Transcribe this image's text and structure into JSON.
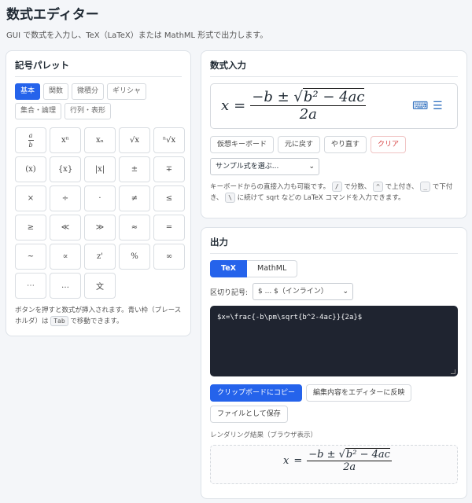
{
  "header": {
    "title": "数式エディター",
    "subtitle": "GUI で数式を入力し、TeX（LaTeX）または MathML 形式で出力します。"
  },
  "palette": {
    "title": "記号パレット",
    "tabs": [
      "基本",
      "関数",
      "微積分",
      "ギリシャ",
      "集合・論理",
      "行列・表形"
    ],
    "keys": [
      "a/b",
      "xⁿ",
      "xₙ",
      "√x",
      "ⁿ√x",
      "(x)",
      "{x}",
      "|x|",
      "±",
      "∓",
      "×",
      "÷",
      "·",
      "≠",
      "≤",
      "≥",
      "≪",
      "≫",
      "≈",
      "=",
      "~",
      "∝",
      "z'",
      "%",
      "∞",
      "⋯",
      "…",
      "文"
    ],
    "help_1": "ボタンを押すと数式が挿入されます。青い枠（プレースホルダ）は",
    "help_key": "Tab",
    "help_2": "で移動できます。"
  },
  "input": {
    "title": "数式入力",
    "formula": {
      "lhs": "x",
      "eq": "=",
      "num_prefix": "−b ± ",
      "radicand": "b² − 4ac",
      "den": "2a"
    },
    "buttons": {
      "virtual_keyboard": "仮想キーボード",
      "undo": "元に戻す",
      "redo": "やり直す",
      "clear": "クリア"
    },
    "sample_placeholder": "サンプル式を選ぶ...",
    "hint": {
      "p1": "キーボードからの直接入力も可能です。",
      "k1": "/",
      "p2": "で分数、",
      "k2": "^",
      "p3": "で上付き、",
      "k3": "_",
      "p4": "で下付き、",
      "k4": "\\",
      "p5": "に続けて sqrt などの LaTeX コマンドを入力できます。"
    }
  },
  "output": {
    "title": "出力",
    "tabs": [
      "TeX",
      "MathML"
    ],
    "delimiter_label": "区切り記号:",
    "delimiter_value": "$ ... $（インライン）",
    "code": "$x=\\frac{-b\\pm\\sqrt{b^2-4ac}}{2a}$",
    "buttons": {
      "copy": "クリップボードにコピー",
      "apply": "編集内容をエディターに反映",
      "save": "ファイルとして保存"
    },
    "render_caption": "レンダリング結果（ブラウザ表示）"
  },
  "colors": {
    "accent": "#2563eb",
    "danger": "#d64545",
    "code_bg": "#1f2430"
  }
}
